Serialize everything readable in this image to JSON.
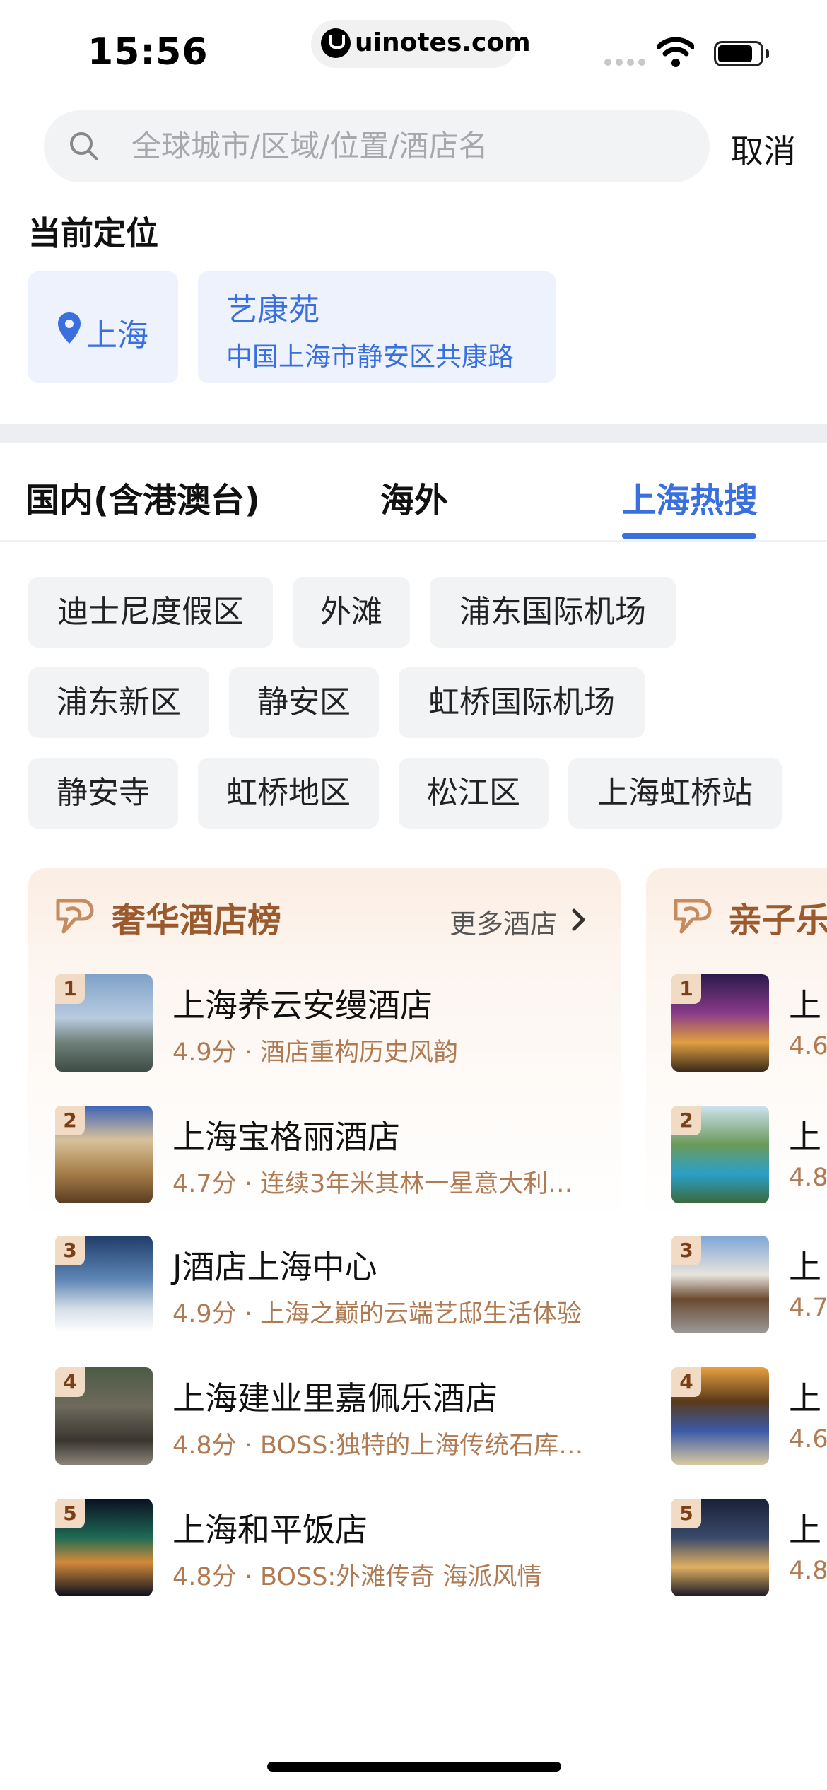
{
  "status_bar": {
    "time": "15:56",
    "url": "uinotes.com"
  },
  "search": {
    "placeholder": "全球城市/区域/位置/酒店名",
    "cancel_label": "取消"
  },
  "current_location": {
    "title": "当前定位",
    "city": "上海",
    "address_name": "艺康苑",
    "address_detail": "中国上海市静安区共康路"
  },
  "tabs": [
    {
      "label": "国内(含港澳台)"
    },
    {
      "label": "海外"
    },
    {
      "label": "上海热搜",
      "active": true
    }
  ],
  "hot_tags": [
    [
      "迪士尼度假区",
      "外滩",
      "浦东国际机场"
    ],
    [
      "浦东新区",
      "静安区",
      "虹桥国际机场"
    ],
    [
      "静安寺",
      "虹桥地区",
      "松江区",
      "上海虹桥站"
    ]
  ],
  "luxury_card": {
    "title": "奢华酒店榜",
    "more_label": "更多酒店",
    "hotels": [
      {
        "rank": "1",
        "name": "上海养云安缦酒店",
        "meta": "4.9分 · 酒店重构历史风韵"
      },
      {
        "rank": "2",
        "name": "上海宝格丽酒店",
        "meta": "4.7分 · 连续3年米其林一星意大利…"
      },
      {
        "rank": "3",
        "name": "J酒店上海中心",
        "meta": "4.9分 · 上海之巅的云端艺邸生活体验"
      },
      {
        "rank": "4",
        "name": "上海建业里嘉佩乐酒店",
        "meta": "4.8分 · BOSS:独特的上海传统石库…"
      },
      {
        "rank": "5",
        "name": "上海和平饭店",
        "meta": "4.8分 · BOSS:外滩传奇 海派风情"
      }
    ]
  },
  "family_card": {
    "title": "亲子乐",
    "hotels": [
      {
        "rank": "1",
        "name": "上",
        "meta": "4.6"
      },
      {
        "rank": "2",
        "name": "上",
        "meta": "4.8"
      },
      {
        "rank": "3",
        "name": "上",
        "meta": "4.7"
      },
      {
        "rank": "4",
        "name": "上",
        "meta": "4.6"
      },
      {
        "rank": "5",
        "name": "上",
        "meta": "4.8"
      }
    ]
  },
  "colors": {
    "accent_blue": "#3a6fe0",
    "card_brown": "#9a5a2e",
    "meta_brown": "#b07a52"
  }
}
